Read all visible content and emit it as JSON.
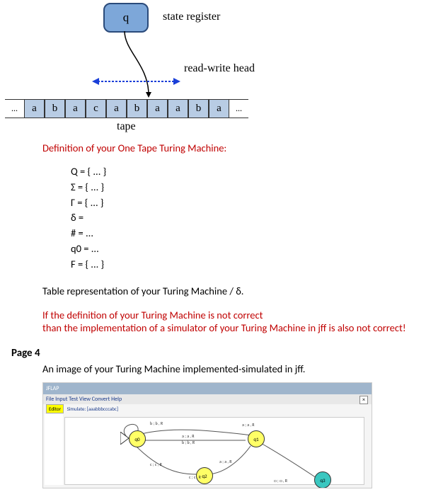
{
  "diagram": {
    "state_letter": "q",
    "label_state_register": "state register",
    "label_read_write_head": "read-write head",
    "tape_cells": [
      "a",
      "b",
      "a",
      "c",
      "a",
      "b",
      "a",
      "a",
      "b",
      "a"
    ],
    "tape_ellipsis": "...",
    "tape_label": "tape"
  },
  "definition": {
    "title": "Definition of your One Tape Turing Machine:",
    "lines": [
      "Q = { ... }",
      "Σ = { ... }",
      "Γ = { ... }",
      "δ =",
      "# = ...",
      "q0 = ...",
      "F = { ... }"
    ],
    "table_caption": "Table representation of your Turing Machine / δ.",
    "warning_line1": "If the definition of your Turing Machine is not correct",
    "warning_line2": "than the implementation of a simulator of your Turing Machine in jff is also not correct!"
  },
  "page4": {
    "label": "Page 4",
    "caption": "An image of your Turing Machine implemented-simulated in jff."
  },
  "jff": {
    "title_bar": "JFLAP",
    "menu": "File  Input  Test  View  Convert  Help",
    "tab_editor": "Editor",
    "tab_sim": "Simulate: [aaabbbcccabc]",
    "close": "×",
    "states": [
      "q0",
      "q1",
      "q2",
      "q3"
    ],
    "transitions": [
      "b ; b , R",
      "a ; a , R",
      "b ; b , R",
      "a ; a , R",
      "c ; c , R",
      "a ; a , R",
      "□ ; □ , R"
    ]
  }
}
